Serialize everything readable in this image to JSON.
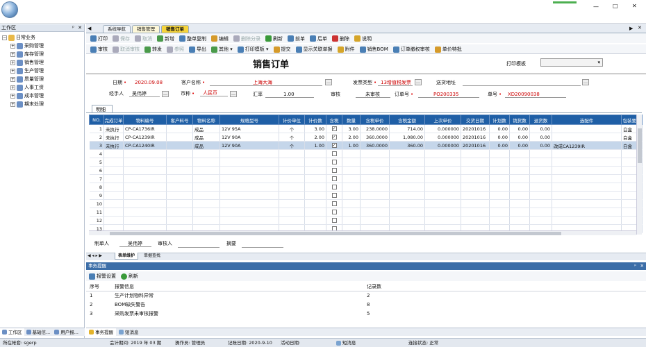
{
  "window": {
    "minimize": "—",
    "maximize": "□",
    "close": "✕"
  },
  "left_panel": {
    "title": "工作区",
    "pin": "ᵖ",
    "close": "✕",
    "tree": [
      {
        "label": "日常业务",
        "level": 0
      },
      {
        "label": "采购管理",
        "level": 1
      },
      {
        "label": "库存管理",
        "level": 1
      },
      {
        "label": "销售管理",
        "level": 1
      },
      {
        "label": "生产管理",
        "level": 1
      },
      {
        "label": "质量管理",
        "level": 1
      },
      {
        "label": "人事工资",
        "level": 1
      },
      {
        "label": "成本管理",
        "level": 1
      },
      {
        "label": "期末处理",
        "level": 1
      }
    ],
    "bottom_tabs": [
      "工作区",
      "基础信...",
      "用户报..."
    ]
  },
  "tabs": [
    "系统导航",
    "销售管理",
    "销售订单"
  ],
  "toolbar1": [
    {
      "label": "打印",
      "dis": false,
      "color": "#4a7fb5"
    },
    {
      "label": "保存",
      "dis": true,
      "color": "#aab"
    },
    {
      "label": "取消",
      "dis": true,
      "color": "#aab"
    },
    {
      "label": "新增",
      "dis": false,
      "color": "#4a9a4a"
    },
    {
      "label": "整单复制",
      "dis": false,
      "color": "#4a7fb5"
    },
    {
      "label": "编辑",
      "dis": false,
      "color": "#d59a2a"
    },
    {
      "label": "删除分录",
      "dis": true,
      "color": "#aab"
    },
    {
      "label": "刷新",
      "dis": false,
      "color": "#3a9a3a"
    },
    {
      "label": "前单",
      "dis": false,
      "color": "#4a7fb5"
    },
    {
      "label": "后单",
      "dis": false,
      "color": "#4a7fb5"
    },
    {
      "label": "删除",
      "dis": false,
      "color": "#c33"
    },
    {
      "label": "说明",
      "dis": false,
      "color": "#d5a52a"
    }
  ],
  "toolbar2": [
    {
      "label": "审核",
      "dis": false,
      "color": "#4a7fb5"
    },
    {
      "label": "取消审核",
      "dis": true,
      "color": "#aab"
    },
    {
      "label": "转发",
      "dis": false,
      "color": "#4a9a4a"
    },
    {
      "label": "参照",
      "dis": true,
      "color": "#aab"
    },
    {
      "label": "导出",
      "dis": false,
      "color": "#4a7fb5"
    },
    {
      "label": "其他 ▾",
      "dis": false,
      "color": "#4a9a4a"
    },
    {
      "label": "打印模板 ▾",
      "dis": false,
      "color": "#4a7fb5"
    },
    {
      "label": "提交",
      "dis": false,
      "color": "#d59a2a"
    },
    {
      "label": "显示关联单据",
      "dis": false,
      "color": "#4a7fb5"
    },
    {
      "label": "附件",
      "dis": false,
      "color": "#d5a52a"
    },
    {
      "label": "销售BOM",
      "dis": false,
      "color": "#4a7fb5"
    },
    {
      "label": "订单撤权审核",
      "dis": false,
      "color": "#4a7fb5"
    },
    {
      "label": "单价特批",
      "dis": false,
      "color": "#d59a2a"
    }
  ],
  "form": {
    "title": "销售订单",
    "print_template_label": "打印模板",
    "date_label": "日期",
    "date": "2020.09.08",
    "customer_label": "客户名称",
    "customer": "上海大海",
    "invoice_type_label": "发票类型",
    "invoice_type": "13增值税发票",
    "delivery_label": "送货地址",
    "delivery": "",
    "handler_label": "经手人",
    "handler": "吴伟婷",
    "currency_label": "币种",
    "currency": "人民币",
    "rate_label": "汇率",
    "rate": "1.00",
    "audit_label": "审核",
    "audit": "未审核",
    "po_label": "订单号",
    "po": "PO200335",
    "doc_label": "单号",
    "doc": "XD20090038"
  },
  "detail": {
    "tab": "明细",
    "columns": [
      "NO.",
      "完成订单",
      "物料编号",
      "客户料号",
      "物料名称",
      "规格型号",
      "计价单位",
      "计价数",
      "含税",
      "数量",
      "含税单价",
      "含税金额",
      "上次单价",
      "交货日期",
      "计划数",
      "销货数",
      "退货数",
      "选配件",
      "包装要求"
    ],
    "rows": [
      {
        "no": "1",
        "status": "未执行",
        "code": "CP-CA1736IR",
        "cust": "",
        "name": "成品",
        "spec": "12V 95A",
        "unit": "个",
        "pq": "3.00",
        "tax": true,
        "qty": "3.00",
        "price": "238.0000",
        "amount": "714.00",
        "last": "0.000000",
        "date": "20201016",
        "plan": "0.00",
        "sold": "0.00",
        "ret": "0.00",
        "opt": "",
        "pack": "白盒"
      },
      {
        "no": "2",
        "status": "未执行",
        "code": "CP-CA1239IR",
        "cust": "",
        "name": "成品",
        "spec": "12V 90A",
        "unit": "个",
        "pq": "2.00",
        "tax": true,
        "qty": "2.00",
        "price": "360.0000",
        "amount": "1,080.00",
        "last": "0.000000",
        "date": "20201016",
        "plan": "0.00",
        "sold": "0.00",
        "ret": "0.00",
        "opt": "",
        "pack": "白盒"
      },
      {
        "no": "3",
        "status": "未执行",
        "code": "CP-CA1240IR",
        "cust": "",
        "name": "成品",
        "spec": "12V 90A",
        "unit": "个",
        "pq": "1.00",
        "tax": true,
        "qty": "1.00",
        "price": "360.0000",
        "amount": "360.00",
        "last": "0.000000",
        "date": "20201016",
        "plan": "0.00",
        "sold": "0.00",
        "ret": "0.00",
        "opt": "改成CA1239IR",
        "pack": "白盒"
      }
    ],
    "empty_rows": [
      "4",
      "5",
      "6",
      "7",
      "8",
      "9",
      "10",
      "11",
      "12",
      "13"
    ]
  },
  "footer_form": {
    "maker_label": "制单人",
    "maker": "吴伟婷",
    "checker_label": "审核人",
    "checker": "",
    "summary_label": "摘要",
    "summary": ""
  },
  "sheet_tabs": [
    "表单维护",
    "单据查找"
  ],
  "reminder": {
    "title": "事务提醒",
    "settings": "报警设置",
    "refresh": "刷新",
    "col_no": "序号",
    "col_info": "报警信息",
    "col_count": "记录数",
    "rows": [
      {
        "no": "1",
        "info": "生产计划物料异常",
        "count": "2"
      },
      {
        "no": "2",
        "info": "BOM缺失警告",
        "count": "8"
      },
      {
        "no": "3",
        "info": "采购发票未审核报警",
        "count": "5"
      }
    ],
    "bottom_tabs": [
      "事务提醒",
      "短消息"
    ]
  },
  "status": {
    "account": "所在帐套: sgerp",
    "period": "会计期间: 2019 年 03 期",
    "operator": "操作员: 管理员",
    "login_date": "记账日期: 2020-9-10",
    "active_date": "活动日期:",
    "msg": "短消息",
    "conn": "连接状态: 正常"
  }
}
